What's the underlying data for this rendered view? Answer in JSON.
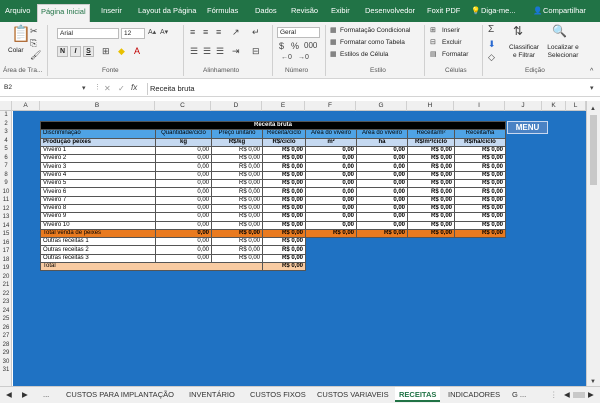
{
  "ribbon_tabs": [
    "Arquivo",
    "Página Inicial",
    "Inserir",
    "Layout da Página",
    "Fórmulas",
    "Dados",
    "Revisão",
    "Exibir",
    "Desenvolvedor",
    "Foxit PDF"
  ],
  "tell_me": "Diga-me...",
  "share": "Compartilhar",
  "ribbon": {
    "paste": "Colar",
    "font_name": "Arial",
    "font_size": "12",
    "bold": "N",
    "italic": "I",
    "underline": "S",
    "number_format": "Geral",
    "cond_format": "Formatação Condicional",
    "format_table": "Formatar como Tabela",
    "cell_styles": "Estilos de Célula",
    "insert": "Inserir",
    "delete": "Excluir",
    "format": "Formatar",
    "sort_filter": "Classificar e Filtrar",
    "find_select": "Localizar e Selecionar",
    "groups": [
      "Área de Tra...",
      "Fonte",
      "Alinhamento",
      "Número",
      "Estilo",
      "Células",
      "Edição"
    ]
  },
  "formula_bar": {
    "name_box": "B2",
    "content": "Receita bruta"
  },
  "columns": [
    "A",
    "B",
    "C",
    "D",
    "E",
    "F",
    "G",
    "H",
    "I",
    "J",
    "K",
    "L"
  ],
  "rows": [
    "1",
    "2",
    "3",
    "4",
    "5",
    "6",
    "7",
    "8",
    "9",
    "10",
    "11",
    "12",
    "13",
    "14",
    "15",
    "16",
    "17",
    "18",
    "19",
    "20",
    "21",
    "22",
    "23",
    "24",
    "25",
    "26",
    "27",
    "28",
    "29",
    "30",
    "31"
  ],
  "table": {
    "title": "Receita bruta",
    "headers": [
      "Discriminação",
      "Quantidade/ciclo",
      "Preço unitário",
      "Receita/ciclo",
      "Área do viveiro",
      "Área do viveiro",
      "Receita/m²",
      "Receita/ha"
    ],
    "units": [
      "Produção peixes",
      "kg",
      "R$/kg",
      "R$/ciclo",
      "m²",
      "ha",
      "R$/m²/ciclo",
      "R$/ha/ciclo"
    ],
    "rows": [
      [
        "Viveiro 1",
        "0,00",
        "R$ 0,00",
        "R$ 0,00",
        "0,00",
        "0,00",
        "R$ 0,00",
        "R$ 0,00"
      ],
      [
        "Viveiro 2",
        "0,00",
        "R$ 0,00",
        "R$ 0,00",
        "0,00",
        "0,00",
        "R$ 0,00",
        "R$ 0,00"
      ],
      [
        "Viveiro 3",
        "0,00",
        "R$ 0,00",
        "R$ 0,00",
        "0,00",
        "0,00",
        "R$ 0,00",
        "R$ 0,00"
      ],
      [
        "Viveiro 4",
        "0,00",
        "R$ 0,00",
        "R$ 0,00",
        "0,00",
        "0,00",
        "R$ 0,00",
        "R$ 0,00"
      ],
      [
        "Viveiro 5",
        "0,00",
        "R$ 0,00",
        "R$ 0,00",
        "0,00",
        "0,00",
        "R$ 0,00",
        "R$ 0,00"
      ],
      [
        "Viveiro 6",
        "0,00",
        "R$ 0,00",
        "R$ 0,00",
        "0,00",
        "0,00",
        "R$ 0,00",
        "R$ 0,00"
      ],
      [
        "Viveiro 7",
        "0,00",
        "R$ 0,00",
        "R$ 0,00",
        "0,00",
        "0,00",
        "R$ 0,00",
        "R$ 0,00"
      ],
      [
        "Viveiro 8",
        "0,00",
        "R$ 0,00",
        "R$ 0,00",
        "0,00",
        "0,00",
        "R$ 0,00",
        "R$ 0,00"
      ],
      [
        "Viveiro 9",
        "0,00",
        "R$ 0,00",
        "R$ 0,00",
        "0,00",
        "0,00",
        "R$ 0,00",
        "R$ 0,00"
      ],
      [
        "Viveiro 10",
        "0,00",
        "R$ 0,00",
        "R$ 0,00",
        "0,00",
        "0,00",
        "R$ 0,00",
        "R$ 0,00"
      ]
    ],
    "total_row": [
      "Total venda de peixes",
      "0,00",
      "R$ 0,00",
      "R$ 0,00",
      "R$ 0,00",
      "R$ 0,00",
      "R$ 0,00",
      "R$ 0,00"
    ],
    "other_rows": [
      [
        "Outras receitas 1",
        "0,00",
        "R$ 0,00",
        "R$ 0,00"
      ],
      [
        "Outras receitas 2",
        "0,00",
        "R$ 0,00",
        "R$ 0,00"
      ],
      [
        "Outras receitas 3",
        "0,00",
        "R$ 0,00",
        "R$ 0,00"
      ]
    ],
    "grand_total": [
      "Total",
      "R$ 0,00"
    ]
  },
  "menu_button": "MENU",
  "sheet_tabs": [
    "...",
    "CUSTOS PARA IMPLANTAÇÃO",
    "INVENTÁRIO",
    "CUSTOS FIXOS",
    "CUSTOS VARIAVEIS",
    "RECEITAS",
    "INDICADORES",
    "G ..."
  ],
  "active_tab": "RECEITAS",
  "colors": {
    "excel_green": "#217346",
    "sheet_blue": "#1f72c3",
    "header_blue": "#4fa3e5",
    "total_orange": "#e97a1f"
  }
}
